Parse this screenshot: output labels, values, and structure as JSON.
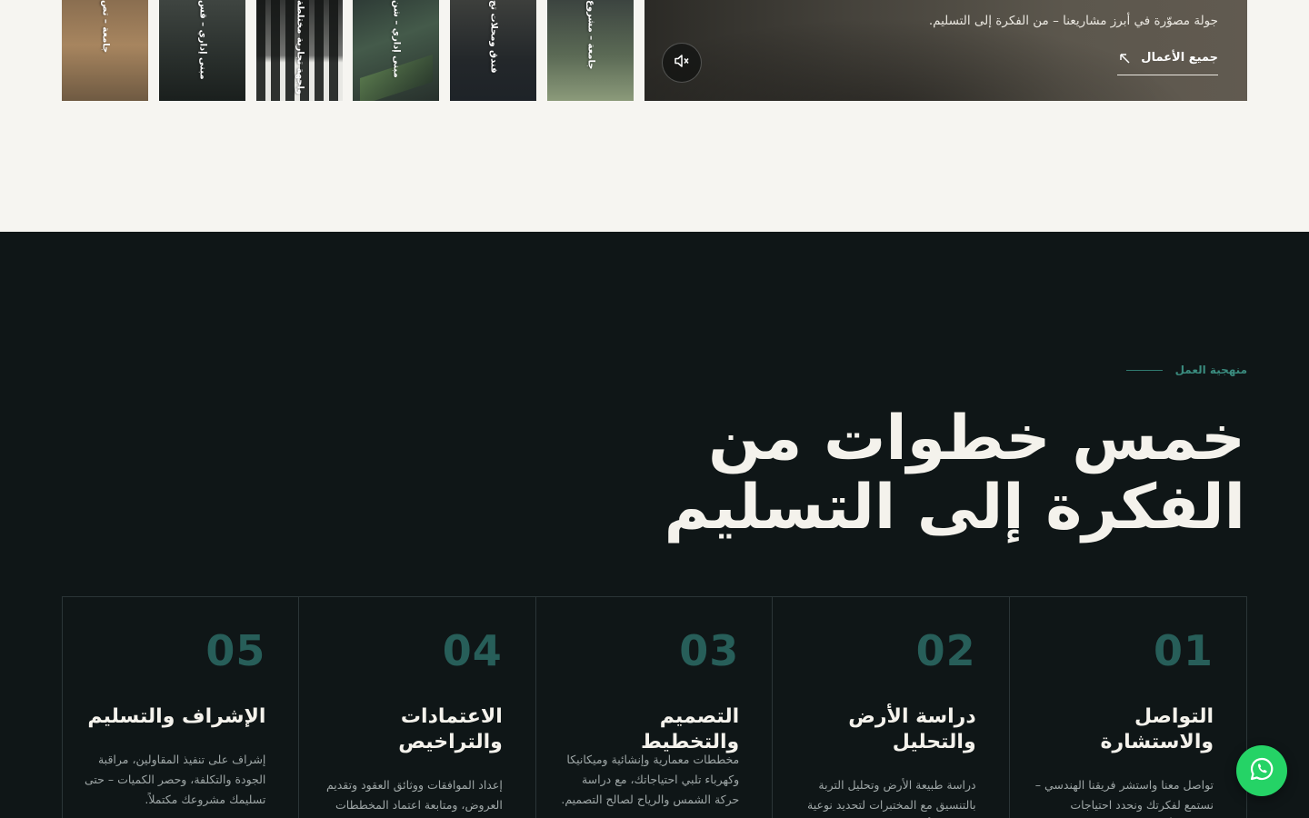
{
  "portfolio": {
    "thumbnails": [
      {
        "caption": "جامعة – تص"
      },
      {
        "caption": "مبنى إداري – قس"
      },
      {
        "caption": "واجهة تجارية مختلطة"
      },
      {
        "caption": "مبنى إداري – شن"
      },
      {
        "caption": "فندق ومحلات تج"
      },
      {
        "caption": "جامعة – مشروع"
      }
    ],
    "hero": {
      "subtitle": "جولة مصوّرة في أبرز مشاريعنا – من الفكرة إلى التسليم.",
      "all_works_label": "جميع الأعمال"
    }
  },
  "methodology": {
    "eyebrow": "منهجية العمل",
    "headline_line1": "خمس خطوات من",
    "headline_line2": "الفكرة إلى التسليم",
    "steps": [
      {
        "number": "01",
        "title": "التواصل والاستشارة",
        "description": "تواصل معنا واستشر فريقنا الهندسي – نستمع لفكرتك ونحدد احتياجات مطبوعة أرضك"
      },
      {
        "number": "02",
        "title": "دراسة الأرض والتحليل",
        "description": "دراسة طبيعة الأرض وتحليل التربة بالتنسيق مع المختبرات لتحديد نوعية التربة والتأكد من جاهزيتها"
      },
      {
        "number": "03",
        "title": "التصميم والتخطيط",
        "description": "مخططات معمارية وإنشائية وميكانيكا وكهرباء تلبي احتياجاتك، مع دراسة حركة الشمس والرياح لصالح التصميم."
      },
      {
        "number": "04",
        "title": "الاعتمادات والتراخيص",
        "description": "إعداد الموافقات ووثائق العقود وتقديم العروض، ومتابعة اعتماد المخططات لدى الجهات الرسمية"
      },
      {
        "number": "05",
        "title": "الإشراف والتسليم",
        "description": "إشراف على تنفيذ المقاولين، مراقبة الجودة والتكلفة، وحصر الكميات – حتى تسليمك مشروعك مكتملاً."
      }
    ]
  },
  "icons": {
    "mute": "speaker-muted-icon",
    "arrow": "arrow-up-left-icon",
    "whatsapp": "whatsapp-icon"
  },
  "colors": {
    "accent": "#2f7a6f",
    "whatsapp": "#25d366",
    "dark_bg": "#0f1617",
    "light_bg": "#f6f5f1"
  }
}
